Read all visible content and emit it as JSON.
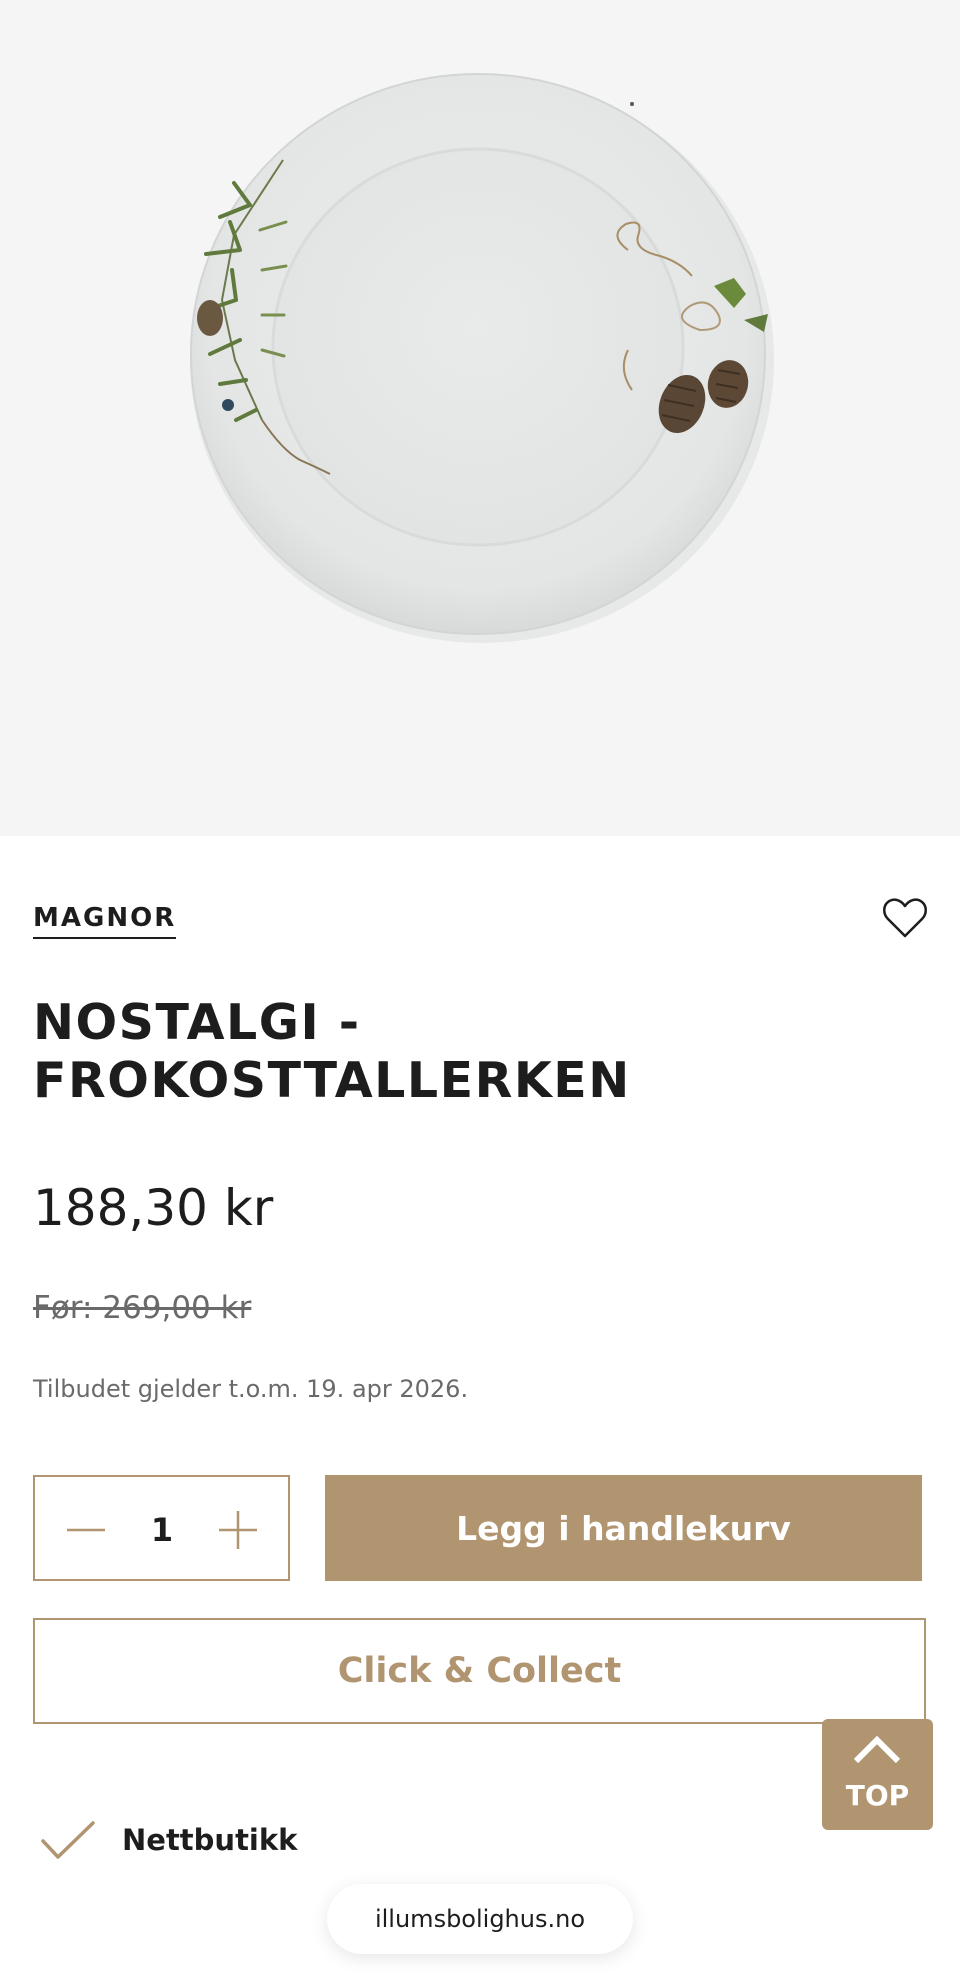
{
  "product": {
    "image_alt": "Nostalgi frokosttallerken",
    "brand": "MAGNOR",
    "title_line1": "NOSTALGI -",
    "title_line2": "FROKOSTTALLERKEN",
    "price": "188,30 kr",
    "old_price": "Før: 269,00 kr",
    "offer_note": "Tilbudet gjelder t.o.m. 19. apr 2026."
  },
  "purchase": {
    "quantity": "1",
    "add_to_cart_label": "Legg i handlekurv",
    "click_collect_label": "Click & Collect"
  },
  "availability": {
    "label": "Nettbutikk"
  },
  "scroll_top": {
    "label": "TOP"
  },
  "browser": {
    "domain": "illumsbolighus.no"
  },
  "colors": {
    "accent": "#b09570",
    "text": "#1d1d1d",
    "muted": "#6a6a6a",
    "hero_bg": "#f5f5f5"
  },
  "icons": {
    "wishlist": "heart-outline-icon",
    "minus": "minus-icon",
    "plus": "plus-icon",
    "scroll_top": "chevron-up-icon",
    "availability": "checkmark-icon"
  }
}
